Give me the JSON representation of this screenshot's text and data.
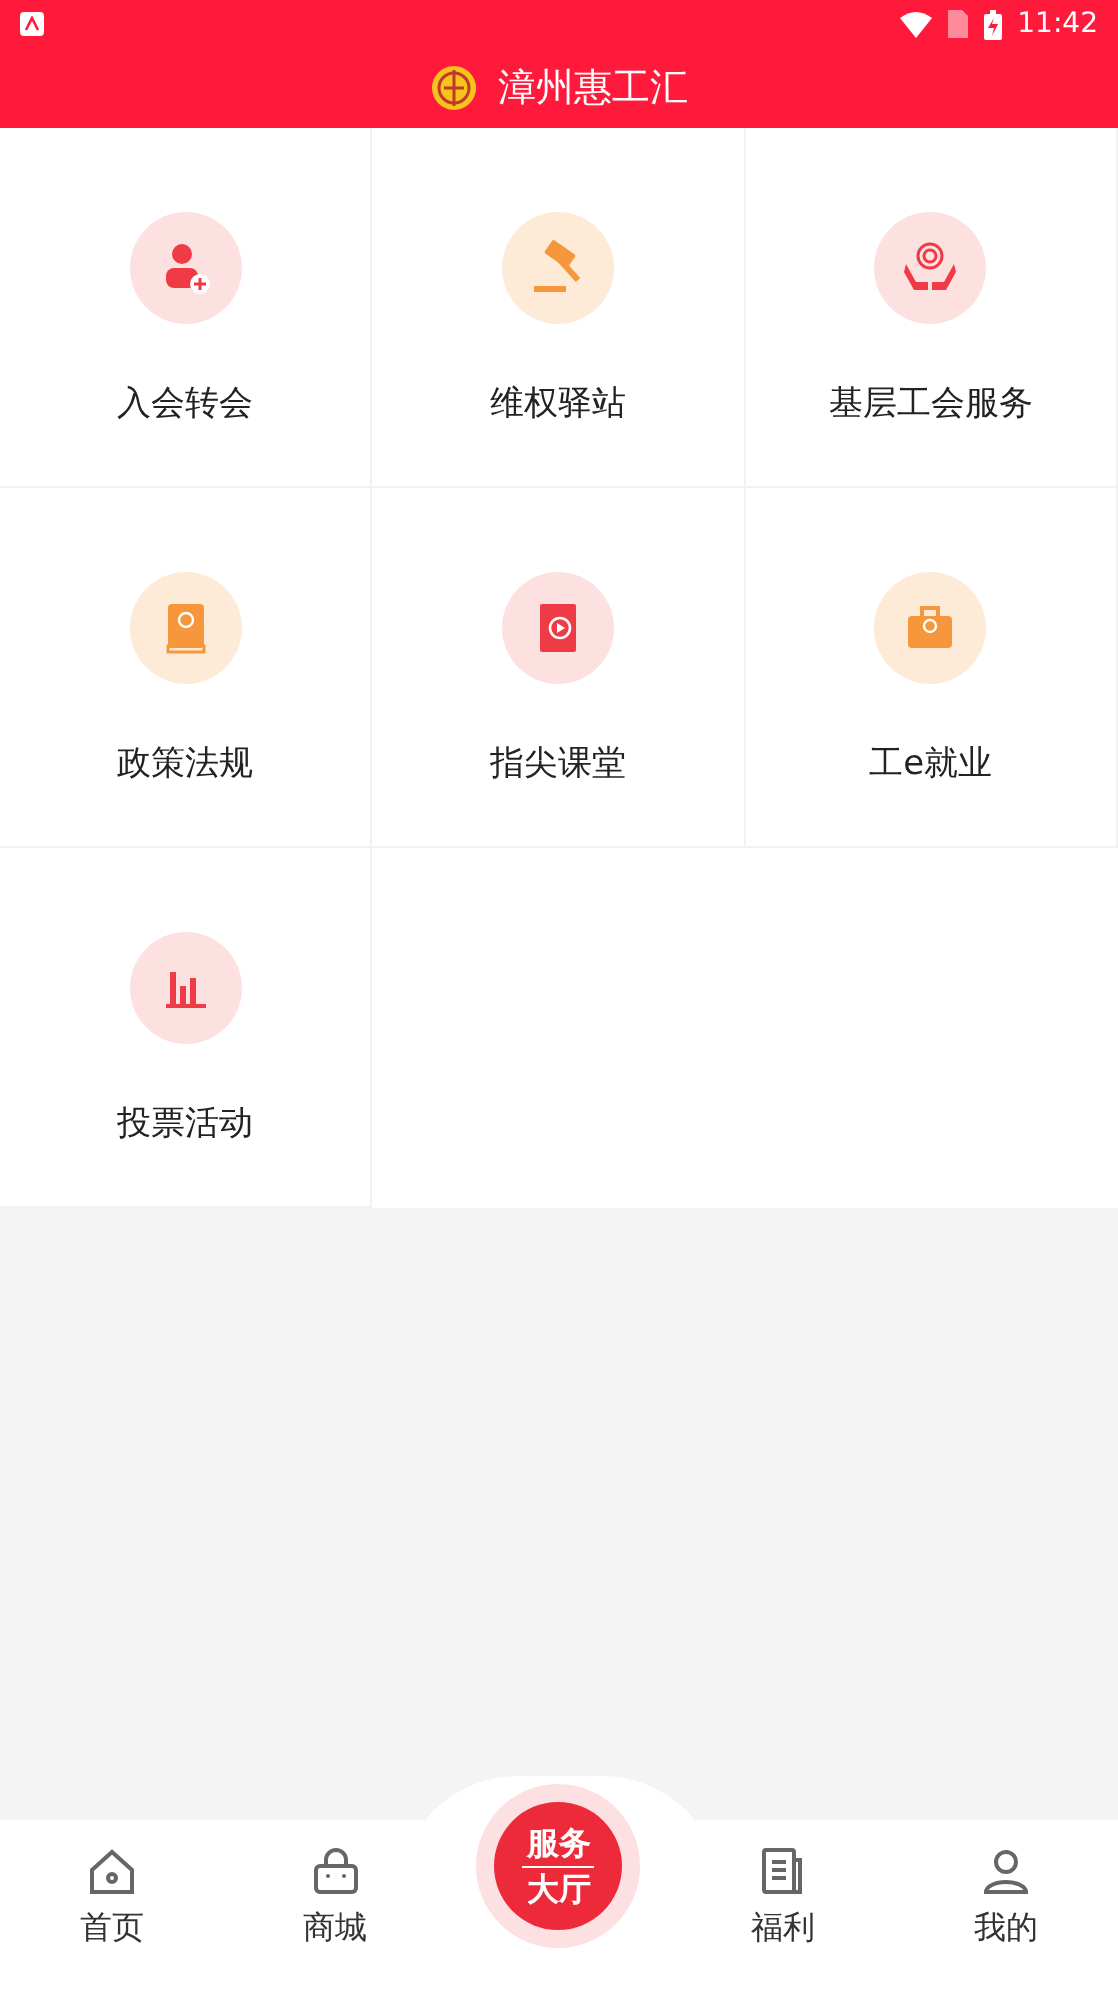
{
  "status_bar": {
    "time": "11:42"
  },
  "header": {
    "title": "漳州惠工汇"
  },
  "services": [
    {
      "label": "入会转会",
      "kind": "member"
    },
    {
      "label": "维权驿站",
      "kind": "gavel"
    },
    {
      "label": "基层工会服务",
      "kind": "hands"
    },
    {
      "label": "政策法规",
      "kind": "book"
    },
    {
      "label": "指尖课堂",
      "kind": "video"
    },
    {
      "label": "工e就业",
      "kind": "briefcase"
    },
    {
      "label": "投票活动",
      "kind": "chart"
    }
  ],
  "bottom_nav": [
    {
      "label": "首页",
      "kind": "home"
    },
    {
      "label": "商城",
      "kind": "bag"
    },
    {
      "kind": "center",
      "lines": [
        "服务",
        "大厅"
      ]
    },
    {
      "label": "福利",
      "kind": "news"
    },
    {
      "label": "我的",
      "kind": "user"
    }
  ]
}
